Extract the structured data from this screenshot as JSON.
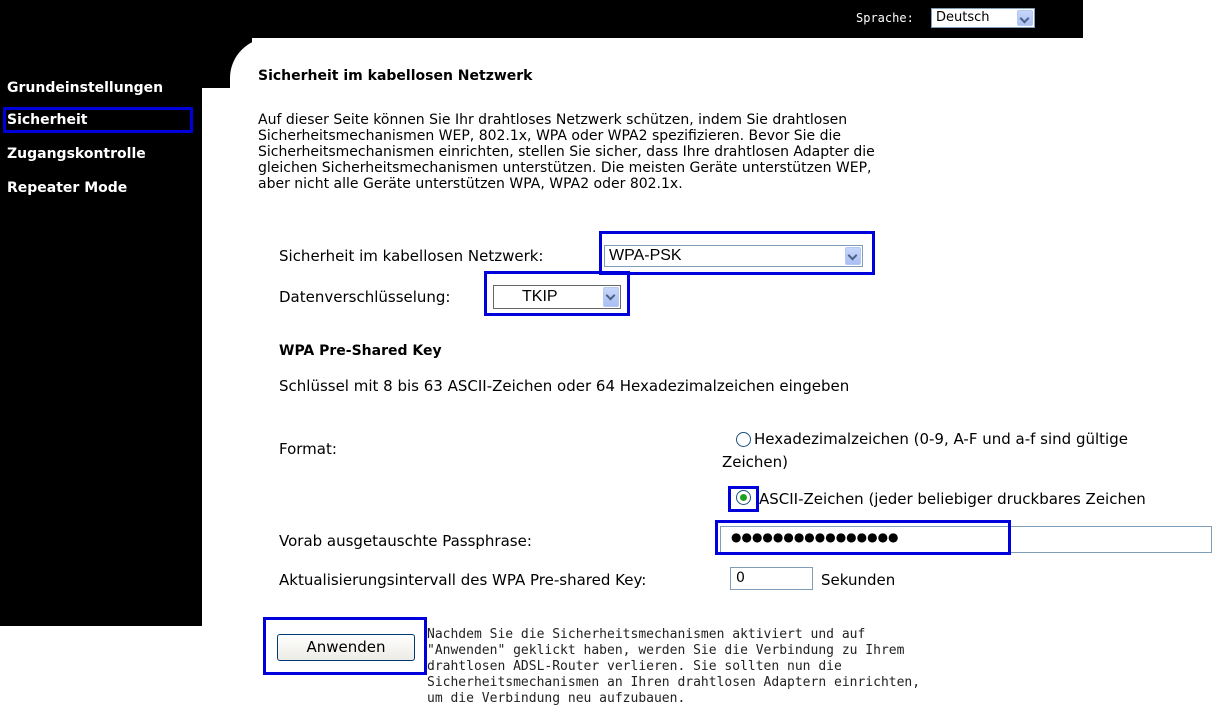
{
  "header": {
    "language_label": "Sprache:",
    "language_value": "Deutsch"
  },
  "sidebar": {
    "items": [
      {
        "label": "Grundeinstellungen"
      },
      {
        "label": "Sicherheit"
      },
      {
        "label": "Zugangskontrolle"
      },
      {
        "label": "Repeater Mode"
      }
    ]
  },
  "main": {
    "title": "Sicherheit im kabellosen Netzwerk",
    "description_lines": [
      "Auf dieser Seite können Sie Ihr drahtloses Netzwerk schützen, indem Sie drahtlosen",
      "Sicherheitsmechanismen WEP, 802.1x, WPA oder WPA2 spezifizieren. Bevor Sie die",
      "Sicherheitsmechanismen einrichten, stellen Sie sicher, dass Ihre drahtlosen Adapter die",
      "gleichen Sicherheitsmechanismen unterstützen. Die meisten Geräte unterstützen WEP,",
      "aber nicht alle Geräte unterstützen WPA, WPA2 oder 802.1x."
    ],
    "security_label": "Sicherheit im kabellosen Netzwerk:",
    "security_value": "WPA-PSK",
    "encryption_label": "Datenverschlüsselung:",
    "encryption_value": "TKIP",
    "psk_heading": "WPA Pre-Shared Key",
    "psk_hint": "Schlüssel mit 8 bis 63 ASCII-Zeichen oder 64 Hexadezimalzeichen eingeben",
    "format_label": "Format:",
    "format_hex_line1": "Hexadezimalzeichen (0-9, A-F und a-f sind gültige",
    "format_hex_line2": "Zeichen)",
    "format_ascii": "ASCII-Zeichen (jeder beliebiger druckbares Zeichen",
    "passphrase_label": "Vorab ausgetauschte Passphrase:",
    "passphrase_value": "●●●●●●●●●●●●●●●●",
    "interval_label": "Aktualisierungsintervall des WPA Pre-shared Key:",
    "interval_value": "0",
    "interval_unit": "Sekunden",
    "apply_label": "Anwenden",
    "apply_note_lines": [
      "Nachdem Sie die Sicherheitsmechanismen aktiviert und auf",
      "\"Anwenden\" geklickt haben, werden Sie die Verbindung zu Ihrem",
      "drahtlosen ADSL-Router verlieren. Sie sollten nun die",
      "Sicherheitsmechanismen an Ihren drahtlosen Adaptern einrichten,",
      "um die Verbindung neu aufzubauen."
    ]
  },
  "colors": {
    "highlight": "#0000dd",
    "chrome": "#000000"
  }
}
